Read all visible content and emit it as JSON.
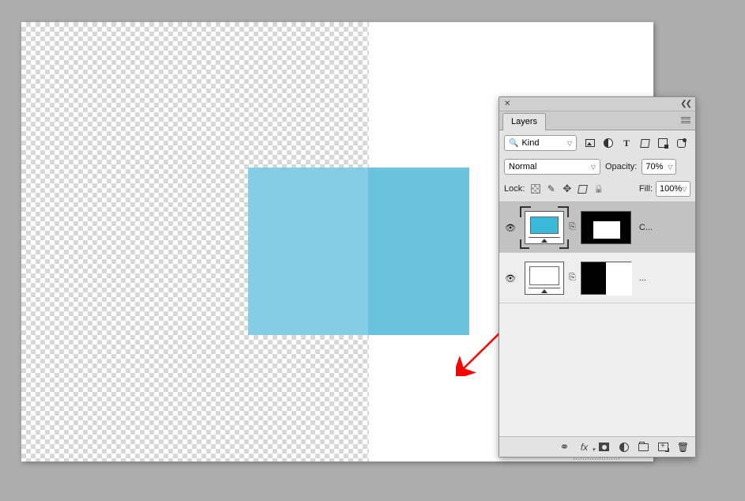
{
  "panel": {
    "tab_label": "Layers",
    "kind_label": "Kind",
    "blend_mode": "Normal",
    "opacity_label": "Opacity:",
    "opacity_value": "70%",
    "lock_label": "Lock:",
    "fill_label": "Fill:",
    "fill_value": "100%",
    "layers": [
      {
        "name": "C..."
      },
      {
        "name": "..."
      }
    ]
  }
}
